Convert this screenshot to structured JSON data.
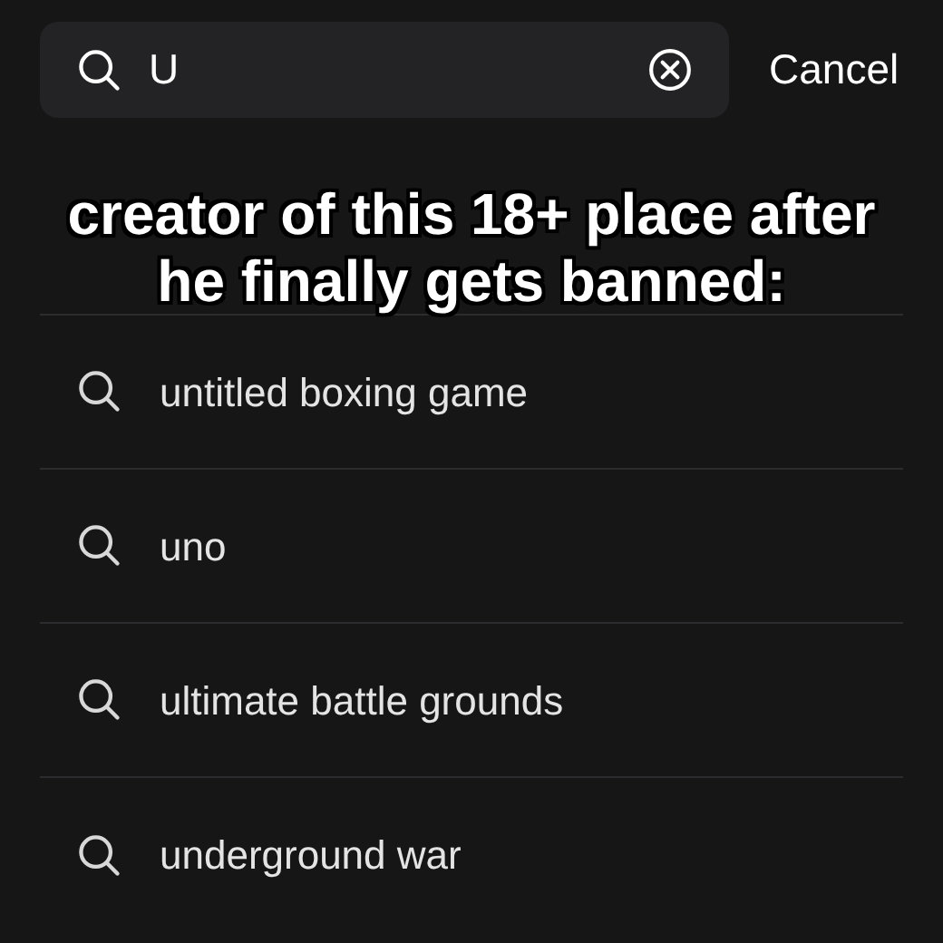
{
  "search": {
    "value": "U",
    "cancel": "Cancel"
  },
  "caption": [
    "creator of this 18+ place after",
    "he finally gets banned:"
  ],
  "suggestions": [
    {
      "label": "untitled boxing game"
    },
    {
      "label": "uno"
    },
    {
      "label": "ultimate battle grounds"
    },
    {
      "label": "underground war"
    }
  ]
}
